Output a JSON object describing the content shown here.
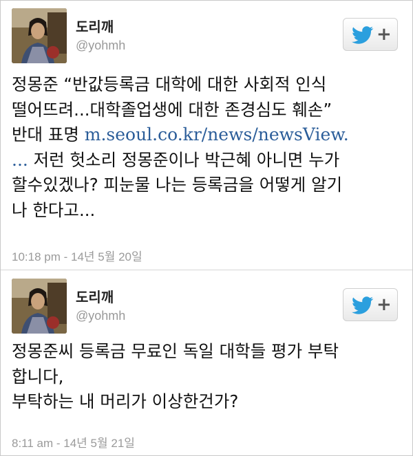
{
  "colors": {
    "link": "#2b5d99",
    "twitter_blue": "#2b9fde",
    "meta_gray": "#999999"
  },
  "tweets": [
    {
      "display_name": "도리깨",
      "handle": "@yohmh",
      "follow_icon": "twitter-bird-icon",
      "follow_plus": "+",
      "lines": [
        "정몽준 “반값등록금 대학에 대한 사회적 인식",
        "떨어뜨려...대학졸업생에 대한 존경심도 훼손”"
      ],
      "line3_prefix": "반대 표명 ",
      "link_text": "m.seoul.co.kr/news/newsView.",
      "link_ellipsis": "...",
      "line4_rest": " 저런 헛소리 정몽준이나 박근혜 아니면 누가",
      "lines_after": [
        "할수있겠나? 피눈물 나는 등록금을 어떻게 알기",
        "나 한다고..."
      ],
      "timestamp": "10:18 pm - 14년 5월 20일"
    },
    {
      "display_name": "도리깨",
      "handle": "@yohmh",
      "follow_icon": "twitter-bird-icon",
      "follow_plus": "+",
      "lines": [
        "정몽준씨 등록금 무료인 독일 대학들 평가 부탁",
        "합니다,",
        "부탁하는 내 머리가 이상한건가?"
      ],
      "timestamp": "8:11 am - 14년 5월 21일"
    }
  ]
}
